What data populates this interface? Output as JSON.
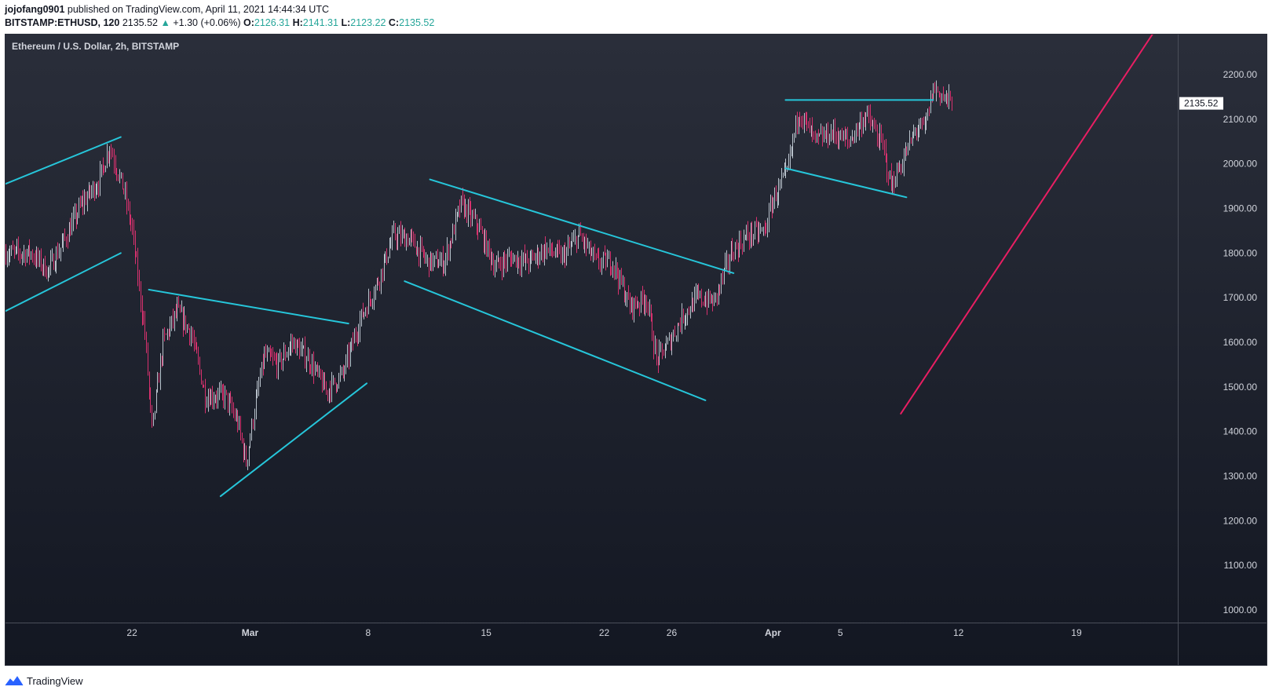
{
  "header": {
    "author": "jojofang0901",
    "published_text": "published on TradingView.com, April 11, 2021 14:44:34 UTC",
    "symbol": "BITSTAMP:ETHUSD, 120",
    "last": "2135.52",
    "change": "+1.30 (+0.06%)",
    "o_label": "O:",
    "o": "2126.31",
    "h_label": "H:",
    "h": "2141.31",
    "l_label": "L:",
    "l": "2123.22",
    "c_label": "C:",
    "c": "2135.52"
  },
  "footer": {
    "brand": "TradingView"
  },
  "colors": {
    "background_top": "#2a2e3a",
    "background_bottom": "#131722",
    "up_candle": "#b9c2cc",
    "down_candle": "#d8316e",
    "trendline": "#26c6da",
    "projection": "#e91e63",
    "axis_text": "#d1d4dc"
  },
  "chart_data": {
    "type": "candlestick",
    "title": "Ethereum / U.S. Dollar, 2h, BITSTAMP",
    "interval": "2h",
    "ylim": [
      950,
      2290
    ],
    "y_ticks": [
      1000,
      1100,
      1200,
      1300,
      1400,
      1500,
      1600,
      1700,
      1800,
      1900,
      2000,
      2100,
      2200
    ],
    "y_tick_labels": [
      "1000.00",
      "1100.00",
      "1200.00",
      "1300.00",
      "1400.00",
      "1500.00",
      "1600.00",
      "1700.00",
      "1800.00",
      "1900.00",
      "2000.00",
      "2100.00",
      "2200.00"
    ],
    "xlim": [
      "2021-02-14T12:00",
      "2021-02-26T20:00"
    ],
    "xlim_days": [
      "2021-02-14T12:00",
      "2021-03-28T02:00"
    ],
    "x_ticks": [
      {
        "date": "2021-02-22",
        "label": "22"
      },
      {
        "date": "2021-03-01",
        "label": "Mar"
      },
      {
        "date": "2021-03-08",
        "label": "8"
      },
      {
        "date": "2021-03-15",
        "label": "15"
      },
      {
        "date": "2021-03-22",
        "label": "22"
      },
      {
        "date": "2021-03-26",
        "label": "26"
      },
      {
        "date": "2021-04-01",
        "label": "Apr"
      },
      {
        "date": "2021-04-05",
        "label": "5"
      },
      {
        "date": "2021-04-12",
        "label": "12"
      },
      {
        "date": "2021-04-19",
        "label": "19"
      },
      {
        "date": "2021-04-26",
        "label": "26"
      }
    ],
    "last_price": 2135.52,
    "last_price_label": "2135.52",
    "price_path": [
      [
        "2021-02-16T00:00",
        1800
      ],
      [
        "2021-02-17T00:00",
        1760
      ],
      [
        "2021-02-18T00:00",
        1830
      ],
      [
        "2021-02-19T00:00",
        1910
      ],
      [
        "2021-02-20T00:00",
        1960
      ],
      [
        "2021-02-20T16:00",
        2040
      ],
      [
        "2021-02-21T12:00",
        1940
      ],
      [
        "2021-02-22T00:00",
        1850
      ],
      [
        "2021-02-22T18:00",
        1620
      ],
      [
        "2021-02-23T04:00",
        1400
      ],
      [
        "2021-02-23T20:00",
        1600
      ],
      [
        "2021-02-24T16:00",
        1670
      ],
      [
        "2021-02-25T12:00",
        1620
      ],
      [
        "2021-02-26T08:00",
        1480
      ],
      [
        "2021-02-27T12:00",
        1480
      ],
      [
        "2021-02-28T06:00",
        1420
      ],
      [
        "2021-02-28T18:00",
        1330
      ],
      [
        "2021-03-01T06:00",
        1450
      ],
      [
        "2021-03-01T20:00",
        1570
      ],
      [
        "2021-03-02T16:00",
        1550
      ],
      [
        "2021-03-03T12:00",
        1600
      ],
      [
        "2021-03-04T12:00",
        1560
      ],
      [
        "2021-03-05T12:00",
        1490
      ],
      [
        "2021-03-06T12:00",
        1530
      ],
      [
        "2021-03-07T12:00",
        1650
      ],
      [
        "2021-03-08T12:00",
        1730
      ],
      [
        "2021-03-09T12:00",
        1840
      ],
      [
        "2021-03-10T12:00",
        1830
      ],
      [
        "2021-03-11T12:00",
        1780
      ],
      [
        "2021-03-12T12:00",
        1780
      ],
      [
        "2021-03-13T12:00",
        1910
      ],
      [
        "2021-03-14T12:00",
        1860
      ],
      [
        "2021-03-15T12:00",
        1770
      ],
      [
        "2021-03-16T12:00",
        1790
      ],
      [
        "2021-03-17T12:00",
        1780
      ],
      [
        "2021-03-18T12:00",
        1810
      ],
      [
        "2021-03-19T12:00",
        1790
      ],
      [
        "2021-03-20T12:00",
        1840
      ],
      [
        "2021-03-21T12:00",
        1780
      ],
      [
        "2021-03-22T12:00",
        1780
      ],
      [
        "2021-03-23T12:00",
        1680
      ],
      [
        "2021-03-24T12:00",
        1700
      ],
      [
        "2021-03-25T02:00",
        1560
      ],
      [
        "2021-03-25T20:00",
        1600
      ],
      [
        "2021-03-26T16:00",
        1660
      ],
      [
        "2021-03-27T12:00",
        1700
      ],
      [
        "2021-03-28T12:00",
        1690
      ],
      [
        "2021-03-29T12:00",
        1800
      ],
      [
        "2021-03-30T12:00",
        1840
      ],
      [
        "2021-03-31T12:00",
        1850
      ],
      [
        "2021-04-01T00:00",
        1920
      ],
      [
        "2021-04-01T20:00",
        1980
      ],
      [
        "2021-04-02T12:00",
        2120
      ],
      [
        "2021-04-03T12:00",
        2050
      ],
      [
        "2021-04-04T12:00",
        2070
      ],
      [
        "2021-04-05T12:00",
        2050
      ],
      [
        "2021-04-06T12:00",
        2110
      ],
      [
        "2021-04-07T12:00",
        2040
      ],
      [
        "2021-04-08T00:00",
        1950
      ],
      [
        "2021-04-08T20:00",
        2020
      ],
      [
        "2021-04-09T12:00",
        2080
      ],
      [
        "2021-04-10T00:00",
        2080
      ],
      [
        "2021-04-10T12:00",
        2170
      ],
      [
        "2021-04-11T14:00",
        2135.52
      ]
    ],
    "annotations": [
      {
        "type": "trendline",
        "from": [
          "2021-02-14T12:00",
          1955
        ],
        "to": [
          "2021-02-21T08:00",
          2060
        ]
      },
      {
        "type": "trendline",
        "from": [
          "2021-02-14T12:00",
          1670
        ],
        "to": [
          "2021-02-21T08:00",
          1800
        ]
      },
      {
        "type": "trendline",
        "from": [
          "2021-02-23T00:00",
          1718
        ],
        "to": [
          "2021-03-06T20:00",
          1642
        ]
      },
      {
        "type": "trendline",
        "from": [
          "2021-02-27T06:00",
          1255
        ],
        "to": [
          "2021-03-07T22:00",
          1508
        ]
      },
      {
        "type": "trendline",
        "from": [
          "2021-03-11T16:00",
          1965
        ],
        "to": [
          "2021-03-29T16:00",
          1755
        ]
      },
      {
        "type": "trendline",
        "from": [
          "2021-03-10T04:00",
          1737
        ],
        "to": [
          "2021-03-28T00:00",
          1470
        ]
      },
      {
        "type": "trendline",
        "from": [
          "2021-04-01T18:00",
          2143
        ],
        "to": [
          "2021-04-10T12:00",
          2143
        ]
      },
      {
        "type": "trendline",
        "from": [
          "2021-04-01T18:00",
          1990
        ],
        "to": [
          "2021-04-08T22:00",
          1925
        ]
      },
      {
        "type": "projection",
        "from": [
          "2021-04-08T14:00",
          1440
        ],
        "to": [
          "2021-04-23T12:00",
          2290
        ]
      }
    ]
  }
}
